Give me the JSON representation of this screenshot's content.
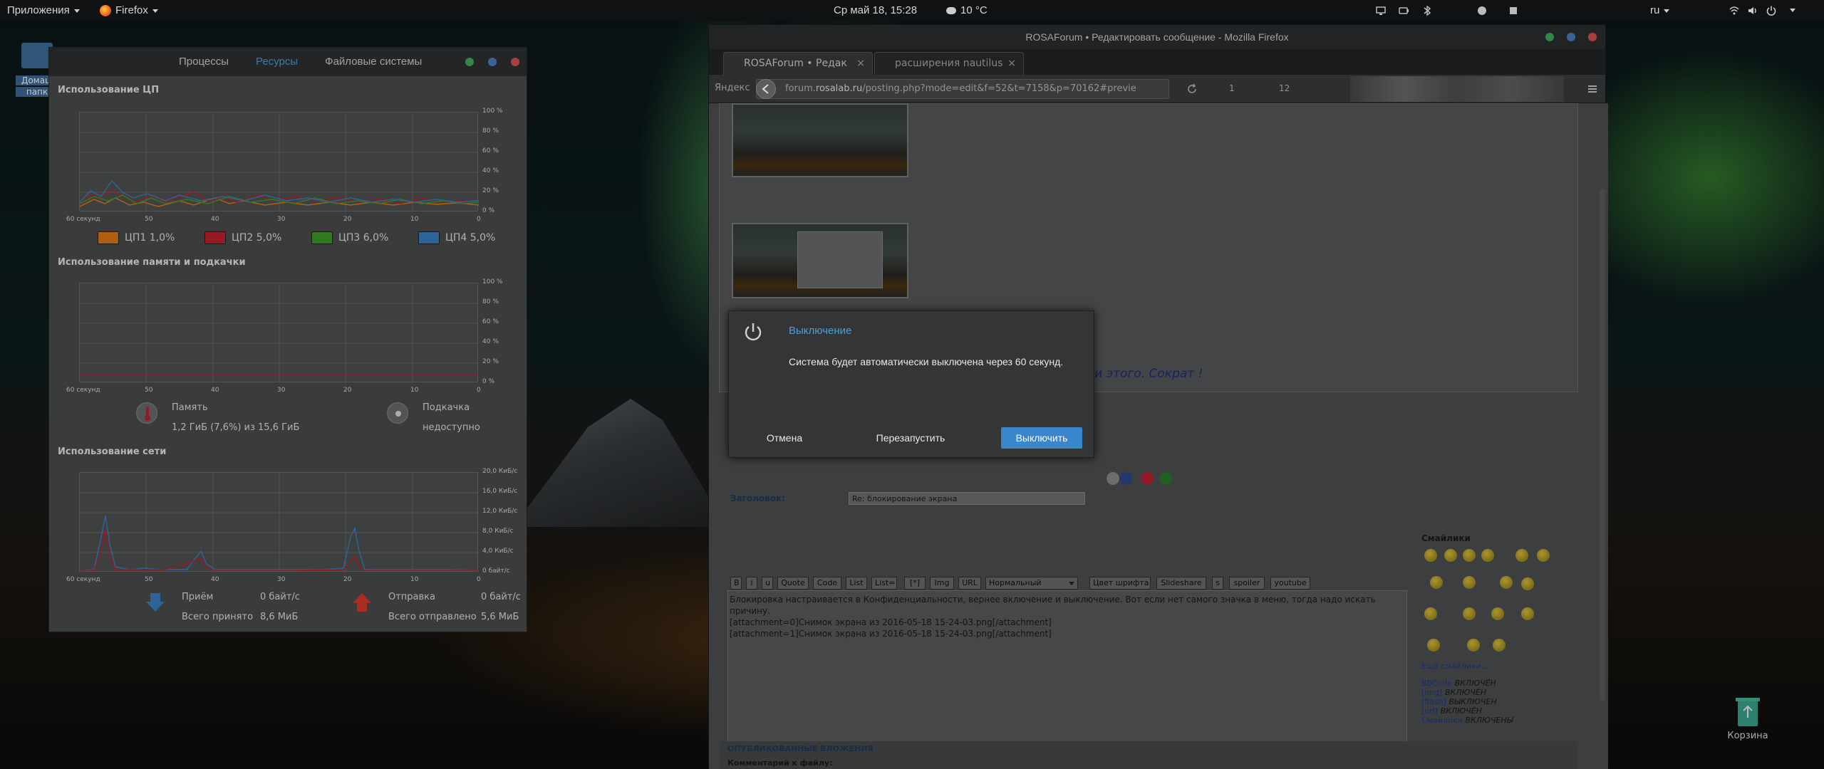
{
  "top_panel": {
    "apps_menu": "Приложения",
    "firefox_menu": "Firefox",
    "clock": "Ср май 18, 15:28",
    "weather": "10 °C",
    "lang": "ru"
  },
  "desktop": {
    "home_label_1": "Домаш",
    "home_label_2": "папк",
    "trash_label": "Корзина"
  },
  "sysmon": {
    "tabs": [
      "Процессы",
      "Ресурсы",
      "Файловые системы"
    ],
    "cpu": {
      "title": "Использование ЦП",
      "yticks": [
        "100 %",
        "80 %",
        "60 %",
        "40 %",
        "20 %",
        "0 %"
      ],
      "xticks": [
        "60 секунд",
        "50",
        "40",
        "30",
        "20",
        "10",
        "0"
      ],
      "legend": [
        {
          "label": "ЦП1  1,0%",
          "color": "#e07a16"
        },
        {
          "label": "ЦП2  5,0%",
          "color": "#c0212f"
        },
        {
          "label": "ЦП3  6,0%",
          "color": "#3f9b2b"
        },
        {
          "label": "ЦП4  5,0%",
          "color": "#3a7fc1"
        }
      ]
    },
    "mem": {
      "title": "Использование памяти и подкачки",
      "yticks": [
        "100 %",
        "80 %",
        "60 %",
        "40 %",
        "20 %",
        "0 %"
      ],
      "xticks": [
        "60 секунд",
        "50",
        "40",
        "30",
        "20",
        "10",
        "0"
      ],
      "memory_label": "Память",
      "memory_value": "1,2 ГиБ (7,6%) из 15,6 ГиБ",
      "swap_label": "Подкачка",
      "swap_value": "недоступно"
    },
    "net": {
      "title": "Использование сети",
      "yticks": [
        "20,0 КиБ/с",
        "16,0 КиБ/с",
        "12,0 КиБ/с",
        "8,0 КиБ/с",
        "4,0 КиБ/с",
        "0 байт/с"
      ],
      "xticks": [
        "60 секунд",
        "50",
        "40",
        "30",
        "20",
        "10",
        "0"
      ],
      "recv_label": "Приём",
      "recv_value": "0 байт/с",
      "recv_total_label": "Всего принято",
      "recv_total_value": "8,6 МиБ",
      "send_label": "Отправка",
      "send_value": "0 байт/с",
      "send_total_label": "Всего отправлено",
      "send_total_value": "5,6 МиБ"
    }
  },
  "firefox": {
    "title": "ROSAForum • Редактировать сообщение - Mozilla Firefox",
    "tabs": [
      {
        "label": "ROSAForum • Редак",
        "close": "×"
      },
      {
        "label": "расширения nautilus",
        "close": "×"
      }
    ],
    "search_engine": "Яндекс",
    "url_prefix": "forum.",
    "url_domain": "rosalab.ru",
    "url_rest": "/posting.php?mode=edit&f=52&t=7158&p=70162#previe",
    "toolbar_counts": [
      "1",
      "12"
    ],
    "quote_text": "т и этого. Сократ !",
    "subject_label": "Заголовок:",
    "subject_value": "Re: блокирование экрана",
    "bbcode_buttons": [
      "B",
      "i",
      "u",
      "Quote",
      "Code",
      "List",
      "List=",
      "[*]",
      "Img",
      "URL"
    ],
    "font_size_select": "Нормальный",
    "bbcode_buttons2": [
      "Цвет шрифта",
      "Slideshare",
      "s",
      "spoiler",
      "youtube"
    ],
    "editor_line1": "Блокировка настраивается в Конфиденциальности, вернее включение и выключение. Вот если нет самого значка в меню, тогда надо искать причину.",
    "editor_line2": "[attachment=0]Снимок экрана из 2016-05-18 15-24-03.png[/attachment]",
    "editor_line3": "[attachment=1]Снимок экрана из 2016-05-18 15-24-03.png[/attachment]",
    "smilies_title": "Смайлики",
    "more_smilies": "Ещё смайлики…",
    "status_lines": [
      {
        "name": "BBCode",
        "state": "ВКЛЮЧЁН"
      },
      {
        "name": "[img]",
        "state": "ВКЛЮЧЁН"
      },
      {
        "name": "[flash]",
        "state": "ВЫКЛЮЧЕН"
      },
      {
        "name": "[url]",
        "state": "ВКЛЮЧЁН"
      },
      {
        "name": "Смайлики",
        "state": "ВКЛЮЧЕНЫ"
      }
    ],
    "attachments_header": "ОПУБЛИКОВАННЫЕ ВЛОЖЕНИЯ",
    "file_comment_label": "Комментарий к файлу:"
  },
  "dialog": {
    "title": "Выключение",
    "message": "Система будет автоматически выключена через 60 секунд.",
    "cancel": "Отмена",
    "restart": "Перезапустить",
    "shutdown": "Выключить"
  }
}
